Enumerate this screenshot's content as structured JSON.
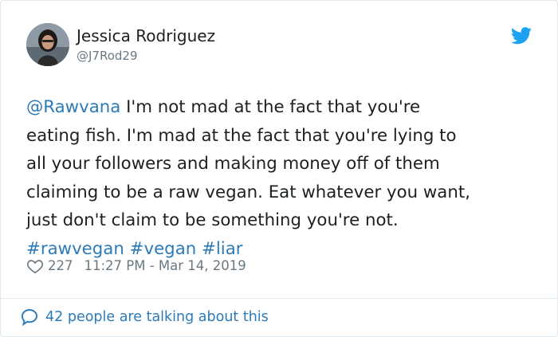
{
  "user": {
    "display_name": "Jessica Rodriguez",
    "handle": "@J7Rod29",
    "avatar_icon": "profile-photo"
  },
  "brand_icon": "twitter-bird-icon",
  "tweet": {
    "mention": "@Rawvana",
    "line1_rest": " I'm not mad at the fact that you're",
    "line2": "eating fish. I'm mad at the fact that you're lying to",
    "line3": "all your followers and making money off of them",
    "line4": "claiming to be a raw vegan. Eat whatever you want,",
    "line5": "just don't claim to be something you're not.",
    "hashtags": [
      "#rawvegan",
      "#vegan",
      "#liar"
    ]
  },
  "meta": {
    "likes": "227",
    "timestamp": "11:27 PM - Mar 14, 2019"
  },
  "footer": {
    "text": "42 people are talking about this"
  },
  "colors": {
    "link": "#2b7bb9",
    "muted": "#697882",
    "text": "#1c2022",
    "border": "#e1e8ed",
    "twitter_blue": "#1da1f2"
  }
}
